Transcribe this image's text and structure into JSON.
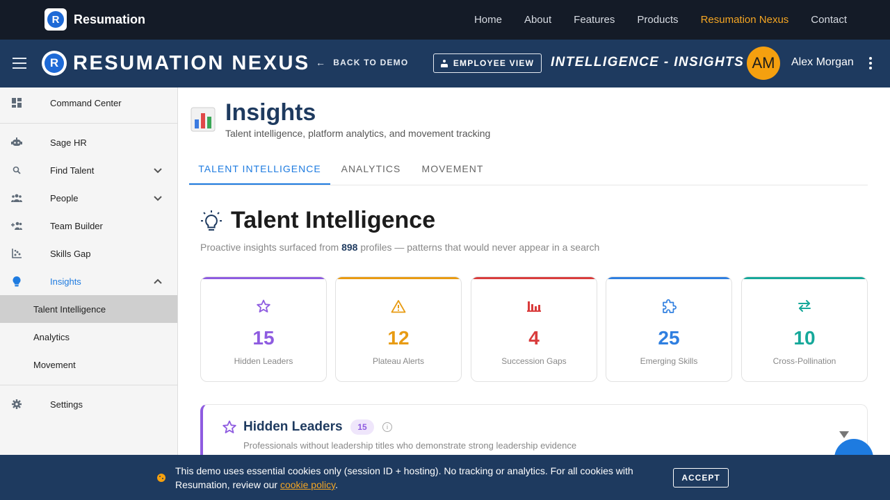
{
  "site_nav": {
    "brand": "Resumation",
    "links": [
      {
        "label": "Home"
      },
      {
        "label": "About"
      },
      {
        "label": "Features"
      },
      {
        "label": "Products"
      },
      {
        "label": "Resumation Nexus"
      },
      {
        "label": "Contact"
      }
    ],
    "active_link": "Resumation Nexus",
    "active_color": "#f5a623"
  },
  "app_header": {
    "title": "RESUMATION NEXUS",
    "back_label": "BACK TO DEMO",
    "employee_view_label": "EMPLOYEE VIEW",
    "page_context": "INTELLIGENCE - INSIGHTS",
    "user_initials": "AM",
    "user_name": "Alex Morgan",
    "bg_color": "#1e3a5f"
  },
  "sidebar": {
    "items": [
      {
        "label": "Command Center",
        "icon": "dashboard-icon"
      },
      {
        "label": "Sage HR",
        "icon": "robot-icon"
      },
      {
        "label": "Find Talent",
        "icon": "search-icon"
      },
      {
        "label": "People",
        "icon": "people-icon"
      },
      {
        "label": "Team Builder",
        "icon": "group-add-icon"
      },
      {
        "label": "Skills Gap",
        "icon": "chart-icon"
      },
      {
        "label": "Insights",
        "icon": "lightbulb-icon"
      },
      {
        "label": "Settings",
        "icon": "gear-icon"
      }
    ],
    "sub_items": [
      {
        "label": "Talent Intelligence"
      },
      {
        "label": "Analytics"
      },
      {
        "label": "Movement"
      }
    ],
    "active_item": "Insights",
    "selected_sub": "Talent Intelligence"
  },
  "page": {
    "title": "Insights",
    "subtitle": "Talent intelligence, platform analytics, and movement tracking",
    "tabs": [
      {
        "label": "TALENT INTELLIGENCE"
      },
      {
        "label": "ANALYTICS"
      },
      {
        "label": "MOVEMENT"
      }
    ],
    "active_tab": "TALENT INTELLIGENCE"
  },
  "section": {
    "title": "Talent Intelligence",
    "sub_prefix": "Proactive insights surfaced from",
    "profile_count": "898",
    "sub_suffix": "profiles — patterns that would never appear in a search"
  },
  "stats": [
    {
      "value": "15",
      "label": "Hidden Leaders",
      "color": "#8e5be0",
      "icon": "star-icon"
    },
    {
      "value": "12",
      "label": "Plateau Alerts",
      "color": "#e89b12",
      "icon": "warning-icon"
    },
    {
      "value": "4",
      "label": "Succession Gaps",
      "color": "#d93c3c",
      "icon": "bar-chart-icon"
    },
    {
      "value": "25",
      "label": "Emerging Skills",
      "color": "#2f7fe0",
      "icon": "puzzle-icon"
    },
    {
      "value": "10",
      "label": "Cross-Pollination",
      "color": "#16a89a",
      "icon": "swap-icon"
    }
  ],
  "panel": {
    "title": "Hidden Leaders",
    "badge": "15",
    "info": "i",
    "description": "Professionals without leadership titles who demonstrate strong leadership evidence"
  },
  "cookie": {
    "text": "This demo uses essential cookies only (session ID + hosting). No tracking or analytics. For all cookies with Resumation, review our",
    "link_label": "cookie policy",
    "end": ".",
    "accept_label": "ACCEPT"
  }
}
